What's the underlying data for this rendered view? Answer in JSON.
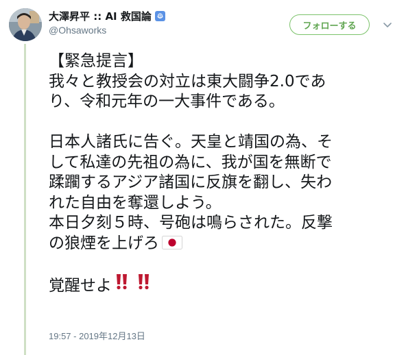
{
  "user": {
    "display_name": "大澤昇平 :: AI 救国論",
    "handle": "@Ohsaworks",
    "badge_icon": "un-flag-icon",
    "badge_color": "#5b92e5"
  },
  "follow_button": {
    "label": "フォローする",
    "color": "#5fa550"
  },
  "menu_icon": "chevron-down-icon",
  "tweet": {
    "lines": [
      "【緊急提言】",
      "我々と教授会の対立は東大闘争2.0であ",
      "り、令和元年の一大事件である。",
      "",
      "日本人諸氏に告ぐ。天皇と靖国の為、そ",
      "して私達の先祖の為に、我が国を無断で",
      "蹂躙するアジア諸国に反旗を翻し、失わ",
      "れた自由を奪還しよう。",
      "本日夕刻５時、号砲は鳴らされた。反撃",
      "の狼煙を上げろ",
      "",
      "覚醒せよ"
    ],
    "emoji": {
      "after_line_10": "japan-flag-icon",
      "after_line_12": "double-exclamation-icon"
    }
  },
  "timestamp": "19:57 - 2019年12月13日",
  "colors": {
    "text": "#14171a",
    "secondary": "#657786",
    "thread_line": "#cfe0c5",
    "exclamation": "#be1931",
    "flag_red": "#bc002d"
  }
}
